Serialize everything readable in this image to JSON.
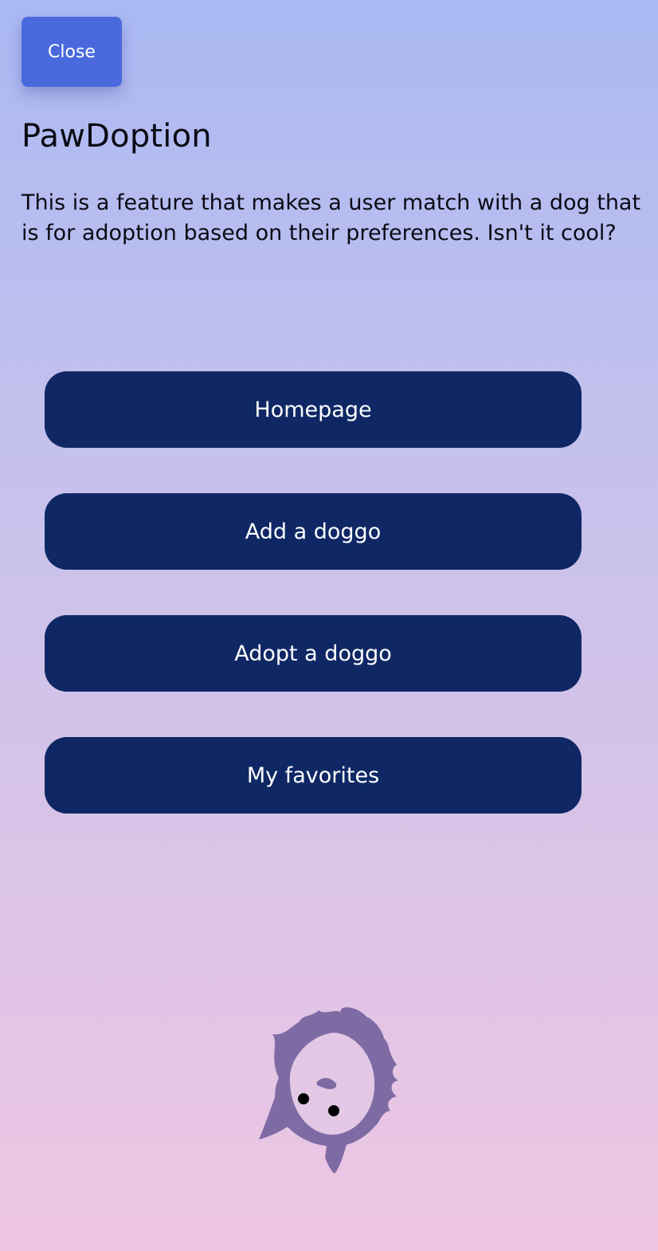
{
  "close_label": "Close",
  "title": "PawDoption",
  "description": "This is a feature that makes a user match with a dog that is for adoption based on their preferences. Isn't it cool?",
  "nav": [
    {
      "label": "Homepage"
    },
    {
      "label": "Add a doggo"
    },
    {
      "label": "Adopt a doggo"
    },
    {
      "label": "My favorites"
    }
  ],
  "mascot": {
    "icon": "dog-mascot-icon",
    "color": "#7f6ba4"
  },
  "colors": {
    "close_button": "#4a69dd",
    "nav_button": "#0f2865",
    "background_top": "#aab9f3",
    "background_bottom": "#efc6e3"
  }
}
